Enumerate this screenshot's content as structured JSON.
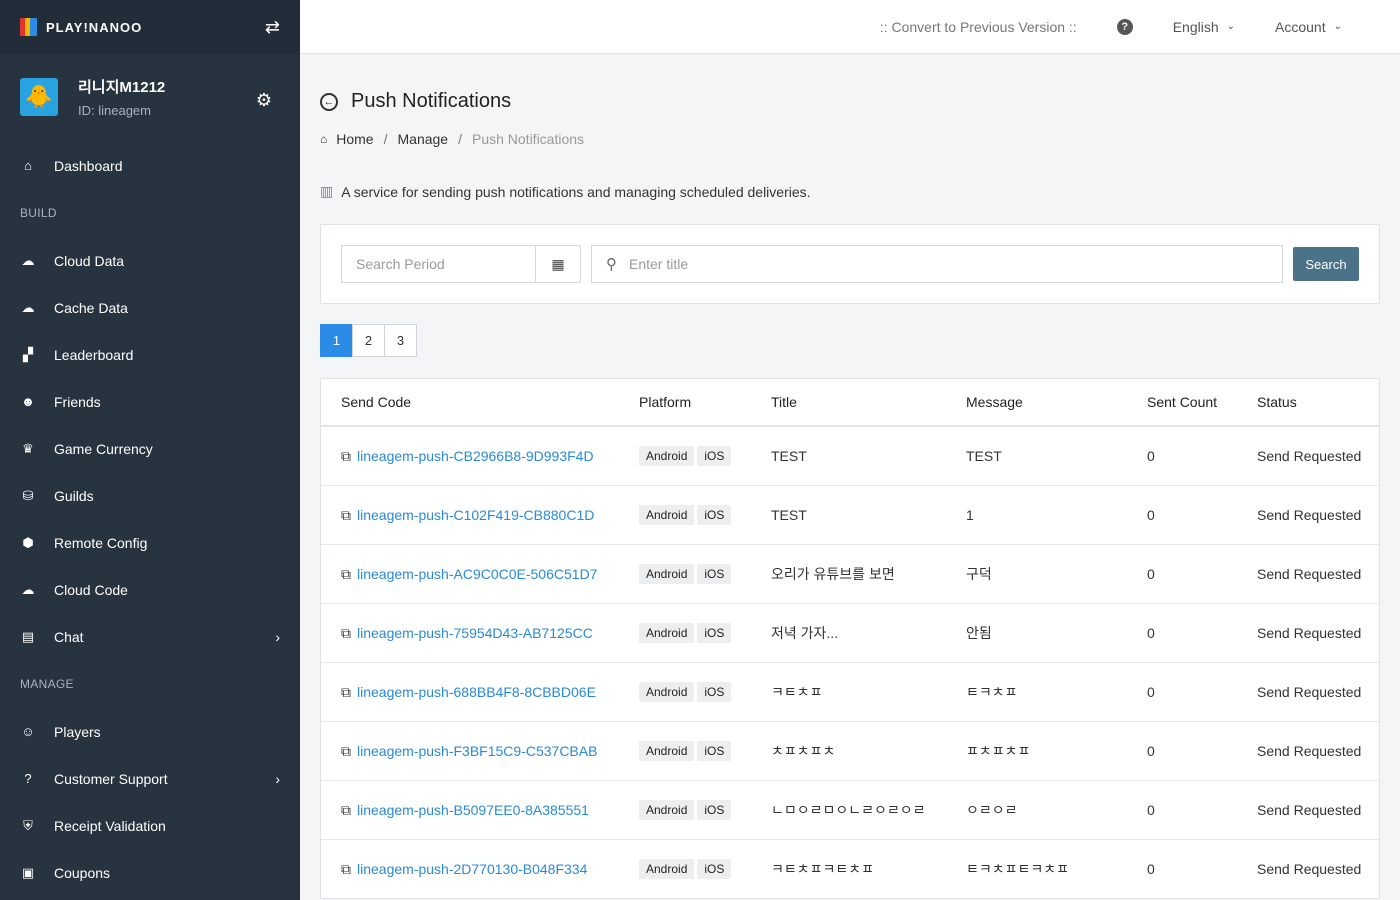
{
  "brand": {
    "logo_text": "PLAY!NANOO"
  },
  "profile": {
    "name": "리니지M1212",
    "id": "ID: lineagem"
  },
  "sidebar": {
    "dashboard": "Dashboard",
    "sections": [
      {
        "title": "BUILD",
        "items": [
          {
            "label": "Cloud Data",
            "icon": "cloud-upload-icon"
          },
          {
            "label": "Cache Data",
            "icon": "cloud-download-icon"
          },
          {
            "label": "Leaderboard",
            "icon": "sitemap-icon"
          },
          {
            "label": "Friends",
            "icon": "user-friends-icon"
          },
          {
            "label": "Game Currency",
            "icon": "coins-icon"
          },
          {
            "label": "Guilds",
            "icon": "database-icon"
          },
          {
            "label": "Remote Config",
            "icon": "cube-icon"
          },
          {
            "label": "Cloud Code",
            "icon": "cloud-code-icon"
          },
          {
            "label": "Chat",
            "icon": "comments-icon",
            "expandable": true
          }
        ]
      },
      {
        "title": "MANAGE",
        "items": [
          {
            "label": "Players",
            "icon": "players-icon"
          },
          {
            "label": "Customer Support",
            "icon": "question-icon",
            "expandable": true
          },
          {
            "label": "Receipt Validation",
            "icon": "shield-icon"
          },
          {
            "label": "Coupons",
            "icon": "ticket-icon"
          }
        ]
      }
    ]
  },
  "header": {
    "convert_link": ":: Convert to Previous Version ::",
    "language": "English",
    "account": "Account"
  },
  "page": {
    "title": "Push Notifications",
    "breadcrumb": [
      "Home",
      "Manage",
      "Push Notifications"
    ],
    "description": "A service for sending push notifications and managing scheduled deliveries."
  },
  "search": {
    "period_placeholder": "Search Period",
    "title_placeholder": "Enter title",
    "button": "Search"
  },
  "pagination": {
    "pages": [
      "1",
      "2",
      "3"
    ],
    "active": "1"
  },
  "table": {
    "headers": [
      "Send Code",
      "Platform",
      "Title",
      "Message",
      "Sent Count",
      "Status"
    ],
    "rows": [
      {
        "code": "lineagem-push-CB2966B8-9D993F4D",
        "platforms": [
          "Android",
          "iOS"
        ],
        "title": "TEST",
        "message": "TEST",
        "count": "0",
        "status": "Send Requested"
      },
      {
        "code": "lineagem-push-C102F419-CB880C1D",
        "platforms": [
          "Android",
          "iOS"
        ],
        "title": "TEST",
        "message": "1",
        "count": "0",
        "status": "Send Requested"
      },
      {
        "code": "lineagem-push-AC9C0C0E-506C51D7",
        "platforms": [
          "Android",
          "iOS"
        ],
        "title": "오리가 유튜브를 보면",
        "message": "구덕",
        "count": "0",
        "status": "Send Requested"
      },
      {
        "code": "lineagem-push-75954D43-AB7125CC",
        "platforms": [
          "Android",
          "iOS"
        ],
        "title": "저녁 가자...",
        "message": "안됨",
        "count": "0",
        "status": "Send Requested"
      },
      {
        "code": "lineagem-push-688BB4F8-8CBBD06E",
        "platforms": [
          "Android",
          "iOS"
        ],
        "title": "ㅋㅌㅊㅍ",
        "message": "ㅌㅋㅊㅍ",
        "count": "0",
        "status": "Send Requested"
      },
      {
        "code": "lineagem-push-F3BF15C9-C537CBAB",
        "platforms": [
          "Android",
          "iOS"
        ],
        "title": "ㅊㅍㅊㅍㅊ",
        "message": "ㅍㅊㅍㅊㅍ",
        "count": "0",
        "status": "Send Requested"
      },
      {
        "code": "lineagem-push-B5097EE0-8A385551",
        "platforms": [
          "Android",
          "iOS"
        ],
        "title": "ㄴㅁㅇㄹㅁㅇㄴㄹㅇㄹㅇㄹ",
        "message": "ㅇㄹㅇㄹ",
        "count": "0",
        "status": "Send Requested"
      },
      {
        "code": "lineagem-push-2D770130-B048F334",
        "platforms": [
          "Android",
          "iOS"
        ],
        "title": "ㅋㅌㅊㅍㅋㅌㅊㅍ",
        "message": "ㅌㅋㅊㅍㅌㅋㅊㅍ",
        "count": "0",
        "status": "Send Requested"
      }
    ]
  },
  "colors": {
    "sidebar_bg": "#283340",
    "link": "#2a8ad8",
    "accent": "#2b8ce8",
    "search_button": "#4a7289"
  }
}
